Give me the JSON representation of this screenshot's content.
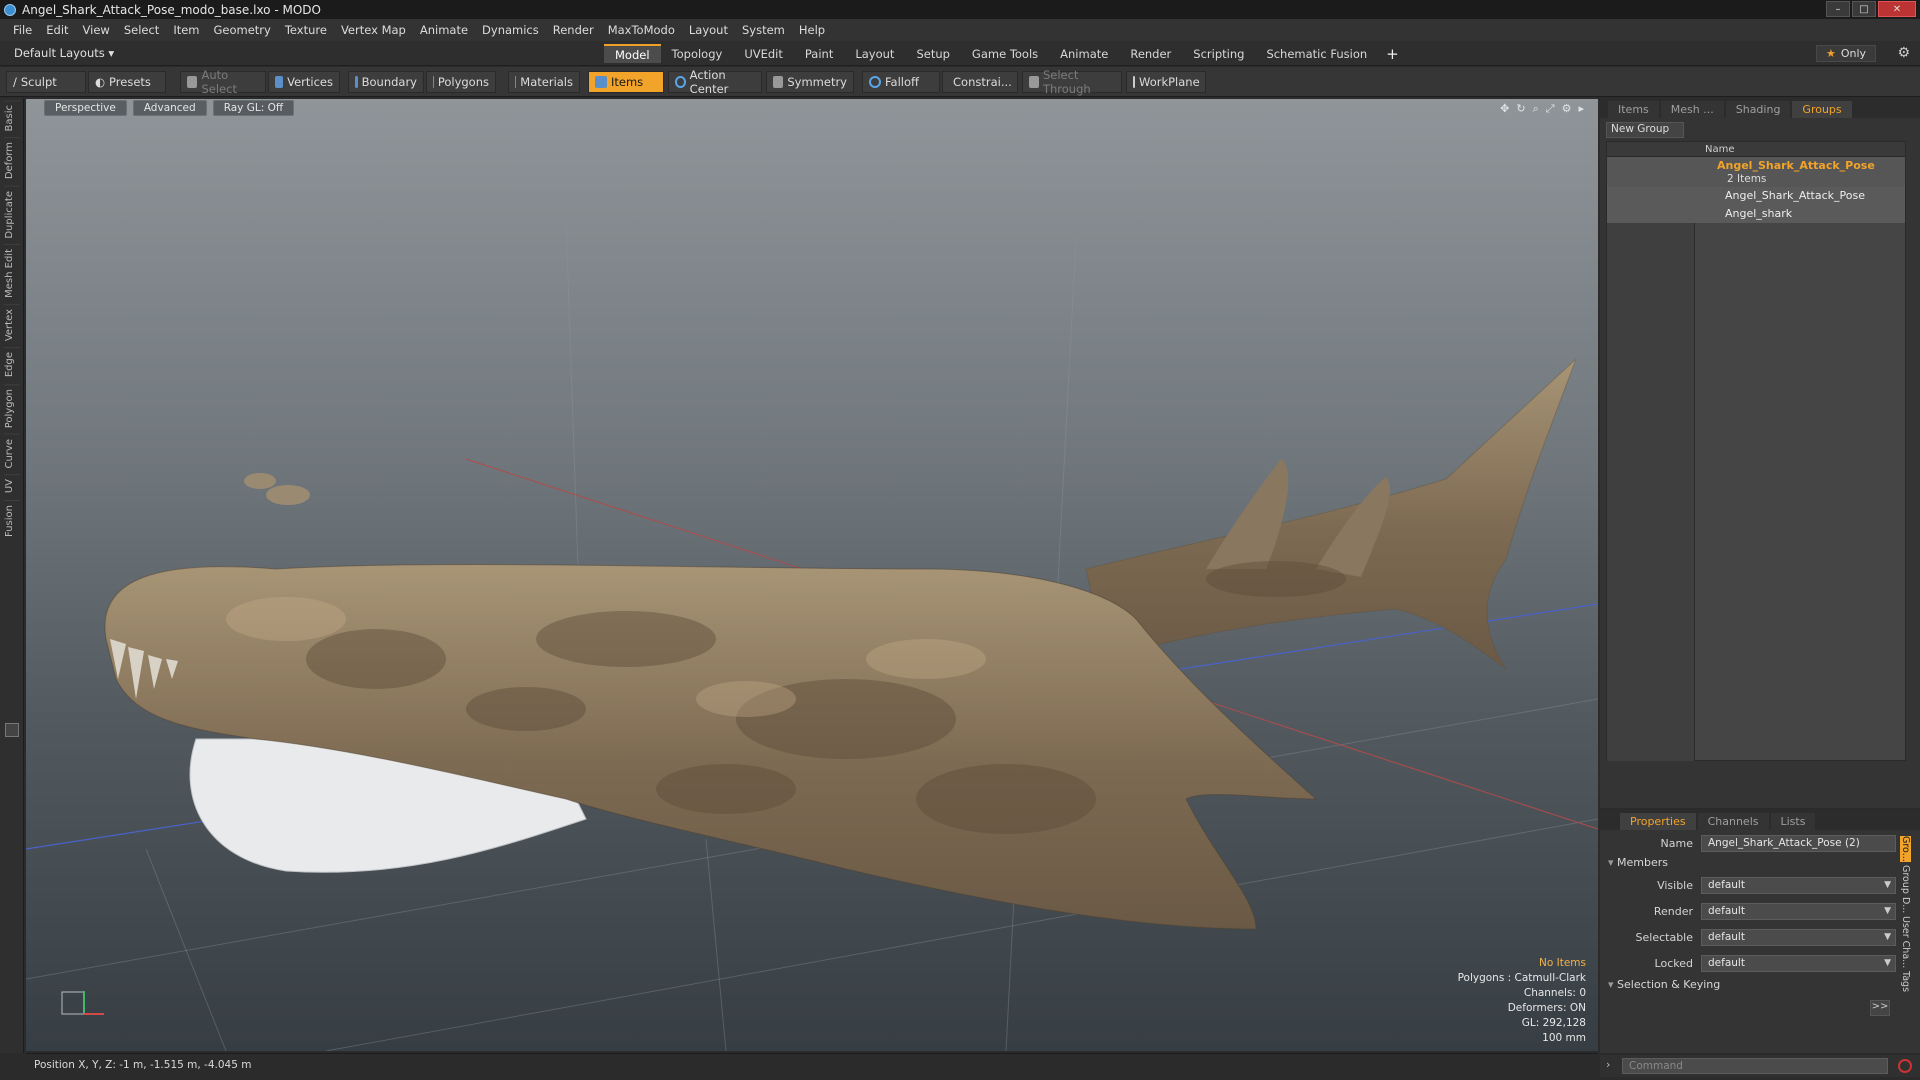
{
  "window": {
    "title": "Angel_Shark_Attack_Pose_modo_base.lxo - MODO",
    "minimize": "–",
    "maximize": "□",
    "close": "✕"
  },
  "menu": [
    "File",
    "Edit",
    "View",
    "Select",
    "Item",
    "Geometry",
    "Texture",
    "Vertex Map",
    "Animate",
    "Dynamics",
    "Render",
    "MaxToModo",
    "Layout",
    "System",
    "Help"
  ],
  "layout_selector": "Default Layouts ▾",
  "mode_tabs": [
    "Model",
    "Topology",
    "UVEdit",
    "Paint",
    "Layout",
    "Setup",
    "Game Tools",
    "Animate",
    "Render",
    "Scripting",
    "Schematic Fusion"
  ],
  "mode_active": "Model",
  "only_label": "Only",
  "toolbar": {
    "sculpt": "Sculpt",
    "presets": "Presets",
    "auto_select": "Auto Select",
    "vertices": "Vertices",
    "boundary": "Boundary",
    "polygons": "Polygons",
    "materials": "Materials",
    "items": "Items",
    "action_center": "Action Center",
    "symmetry": "Symmetry",
    "falloff": "Falloff",
    "constraints": "Constrai...",
    "select_through": "Select Through",
    "workplane": "WorkPlane"
  },
  "left_tabs": [
    "Basic",
    "Deform",
    "Duplicate",
    "Mesh Edit",
    "Vertex",
    "Edge",
    "Polygon",
    "Curve",
    "UV",
    "Fusion"
  ],
  "viewport": {
    "view": "Perspective",
    "shading": "Advanced",
    "ray_gl": "Ray GL: Off",
    "info": {
      "no_items": "No Items",
      "polygons": "Polygons : Catmull-Clark",
      "channels": "Channels: 0",
      "deformers": "Deformers: ON",
      "gl": "GL: 292,128",
      "scale": "100 mm"
    }
  },
  "status_bar": "Position X, Y, Z:  -1 m, -1.515 m, -4.045 m",
  "right_panel": {
    "tabs": [
      "Items",
      "Mesh ...",
      "Shading",
      "Groups"
    ],
    "active_tab": "Groups",
    "new_group": "New Group",
    "column_name": "Name",
    "group": {
      "name": "Angel_Shark_Attack_Pose",
      "count": "2 Items"
    },
    "children": [
      "Angel_Shark_Attack_Pose",
      "Angel_shark"
    ]
  },
  "properties": {
    "tabs": [
      "Properties",
      "Channels",
      "Lists"
    ],
    "active_tab": "Properties",
    "name_label": "Name",
    "name_value": "Angel_Shark_Attack_Pose (2)",
    "members_section": "Members",
    "fields": [
      {
        "label": "Visible",
        "value": "default"
      },
      {
        "label": "Render",
        "value": "default"
      },
      {
        "label": "Selectable",
        "value": "default"
      },
      {
        "label": "Locked",
        "value": "default"
      }
    ],
    "selection_section": "Selection & Keying",
    "side_tabs": [
      "Gro...",
      "Group D...",
      "User Cha...",
      "Tags"
    ],
    "more": ">>"
  },
  "command": {
    "placeholder": "Command"
  },
  "colors": {
    "accent": "#f2a32a",
    "selection_orange": "#f2a32a"
  }
}
